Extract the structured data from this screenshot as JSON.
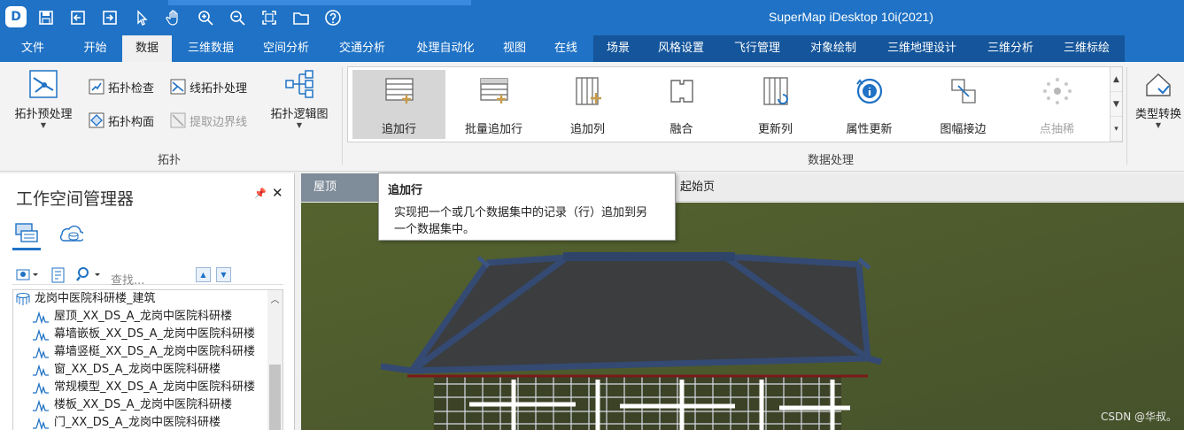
{
  "titlebar": {
    "app_title": "SuperMap iDesktop 10i(2021)",
    "logo_letter": "D"
  },
  "menu": {
    "tabs": [
      "文件",
      "开始",
      "数据",
      "三维数据",
      "空间分析",
      "交通分析",
      "处理自动化",
      "视图",
      "在线",
      "场景",
      "风格设置",
      "飞行管理",
      "对象绘制",
      "三维地理设计",
      "三维分析",
      "三维标绘"
    ],
    "active": "数据"
  },
  "ribbon": {
    "topology": {
      "preprocess": "拓扑预处理",
      "check": "拓扑检查",
      "line_process": "线拓扑处理",
      "build_polygon": "拓扑构面",
      "extract_boundary": "提取边界线",
      "logic_graph": "拓扑逻辑图",
      "group_label": "拓扑"
    },
    "data_processing": {
      "items": [
        "追加行",
        "批量追加行",
        "追加列",
        "融合",
        "更新列",
        "属性更新",
        "图幅接边",
        "点抽稀"
      ],
      "group_label": "数据处理"
    },
    "type_convert": "类型转换"
  },
  "tooltip": {
    "title": "追加行",
    "line1": "实现把一个或几个数据集中的记录（行）追加到另",
    "line2": "一个数据集中。"
  },
  "workspace": {
    "title": "工作空间管理器",
    "search_placeholder": "查找...",
    "root": "龙岗中医院科研楼_建筑",
    "items": [
      "屋顶_XX_DS_A_龙岗中医院科研楼",
      "幕墙嵌板_XX_DS_A_龙岗中医院科研楼",
      "幕墙竖梃_XX_DS_A_龙岗中医院科研楼",
      "窗_XX_DS_A_龙岗中医院科研楼",
      "常规模型_XX_DS_A_龙岗中医院科研楼",
      "楼板_XX_DS_A_龙岗中医院科研楼",
      "门_XX_DS_A_龙岗中医院科研楼"
    ]
  },
  "doc_tabs": {
    "active": "屋顶_XX_DS",
    "start": "起始页"
  },
  "watermark": "CSDN @华叔。",
  "colors": {
    "accent": "#1f72c5",
    "accent_dark": "#14559b",
    "grass": "#4d5a30",
    "roof": "#3b3d3f",
    "eave": "#344a72"
  }
}
